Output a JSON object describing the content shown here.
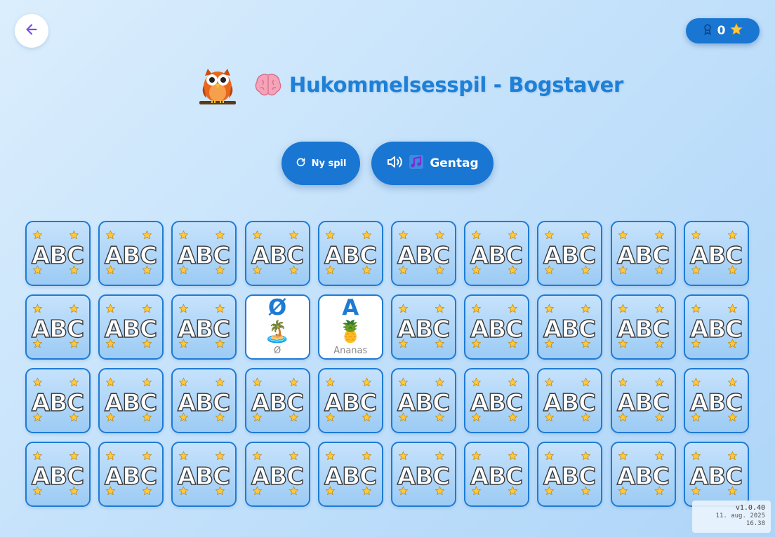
{
  "app": {
    "title": "Hukommelsesspil - Bogstaver"
  },
  "nav": {
    "back_icon": "arrow-left-icon"
  },
  "score": {
    "value": "0",
    "icon": "award-icon",
    "star": "⭐"
  },
  "header": {
    "title": "Hukommelsesspil - Bogstaver",
    "mascot": "owl",
    "title_emoji": "🧠"
  },
  "controls": {
    "new_game_label": "Ny spil",
    "new_game_icon": "refresh-icon",
    "repeat_label": "Gentag",
    "repeat_icon": "volume-icon",
    "repeat_emoji": "🎵"
  },
  "grid": {
    "rows": 4,
    "columns": 10,
    "card_back_label": "ABC",
    "revealed": [
      {
        "index": 13,
        "letter": "Ø",
        "emoji": "🏝️",
        "word": "Ø"
      },
      {
        "index": 14,
        "letter": "A",
        "emoji": "🍍",
        "word": "Ananas"
      }
    ]
  },
  "version": {
    "number": "v1.0.40",
    "date": "11. aug. 2025",
    "time": "16.38"
  },
  "colors": {
    "primary": "#1976d2",
    "title": "#1e80d6",
    "card_border": "#1e7bd4",
    "star": "#f7c948"
  }
}
